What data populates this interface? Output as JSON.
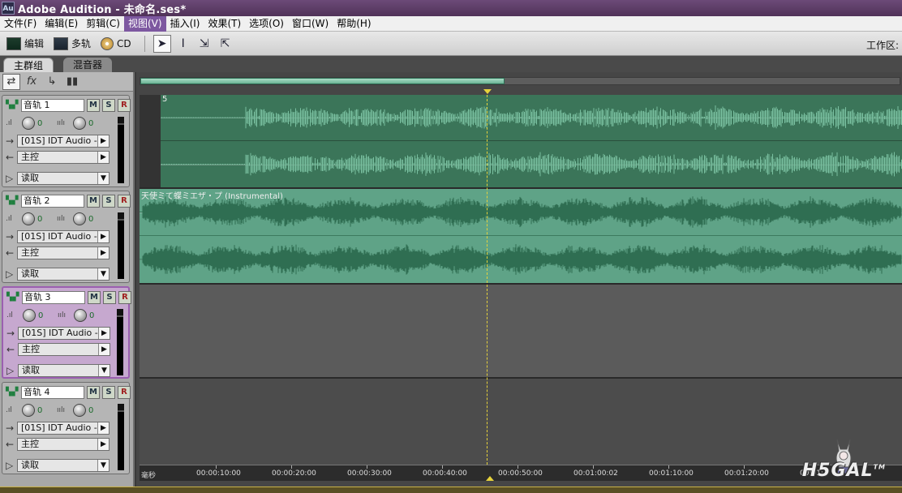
{
  "title_bar": {
    "icon": "Au",
    "title": "Adobe Audition - 未命名.ses*"
  },
  "menu": [
    "文件(F)",
    "编辑(E)",
    "剪辑(C)",
    "视图(V)",
    "插入(I)",
    "效果(T)",
    "选项(O)",
    "窗口(W)",
    "帮助(H)"
  ],
  "menu_active_index": 3,
  "toolbar": {
    "edit_label": "编辑",
    "multitrack_label": "多轨",
    "cd_label": "CD",
    "workspace_label": "工作区:"
  },
  "tabs": {
    "main_group": "主群组",
    "mixer": "混音器"
  },
  "tracks": [
    {
      "name": "音轨 1",
      "vol": "0",
      "pan": "0",
      "input": "[01S] IDT Audio -",
      "output": "主控",
      "automation": "读取",
      "selected": false
    },
    {
      "name": "音轨 2",
      "vol": "0",
      "pan": "0",
      "input": "[01S] IDT Audio -",
      "output": "主控",
      "automation": "读取",
      "selected": false
    },
    {
      "name": "音轨 3",
      "vol": "0",
      "pan": "0",
      "input": "[01S] IDT Audio -",
      "output": "主控",
      "automation": "读取",
      "selected": true
    },
    {
      "name": "音轨 4",
      "vol": "0",
      "pan": "0",
      "input": "[01S] IDT Audio -",
      "output": "主控",
      "automation": "读取",
      "selected": false
    }
  ],
  "track_buttons": {
    "mute": "M",
    "solo": "S",
    "record": "R"
  },
  "clips": {
    "clip1_title": "5",
    "clip2_title": "天使ミて蝶ミエザ・プ (Instrumental)"
  },
  "ruler": {
    "unit": "毫秒",
    "ticks": [
      "00:00:10:00",
      "00:00:20:00",
      "00:00:30:00",
      "00:00:40:00",
      "00:00:50:00",
      "00:01:00:02",
      "00:01:10:00",
      "00:01:20:00",
      "00:01:4"
    ]
  },
  "overview_range": 0.48,
  "colors": {
    "accent": "#7d58a0",
    "clip_green": "#5fa387",
    "clip_dark": "#3d7a5e",
    "playhead": "#e6d23c"
  },
  "watermark": {
    "text": "H5GAL",
    "tm": "TM"
  }
}
